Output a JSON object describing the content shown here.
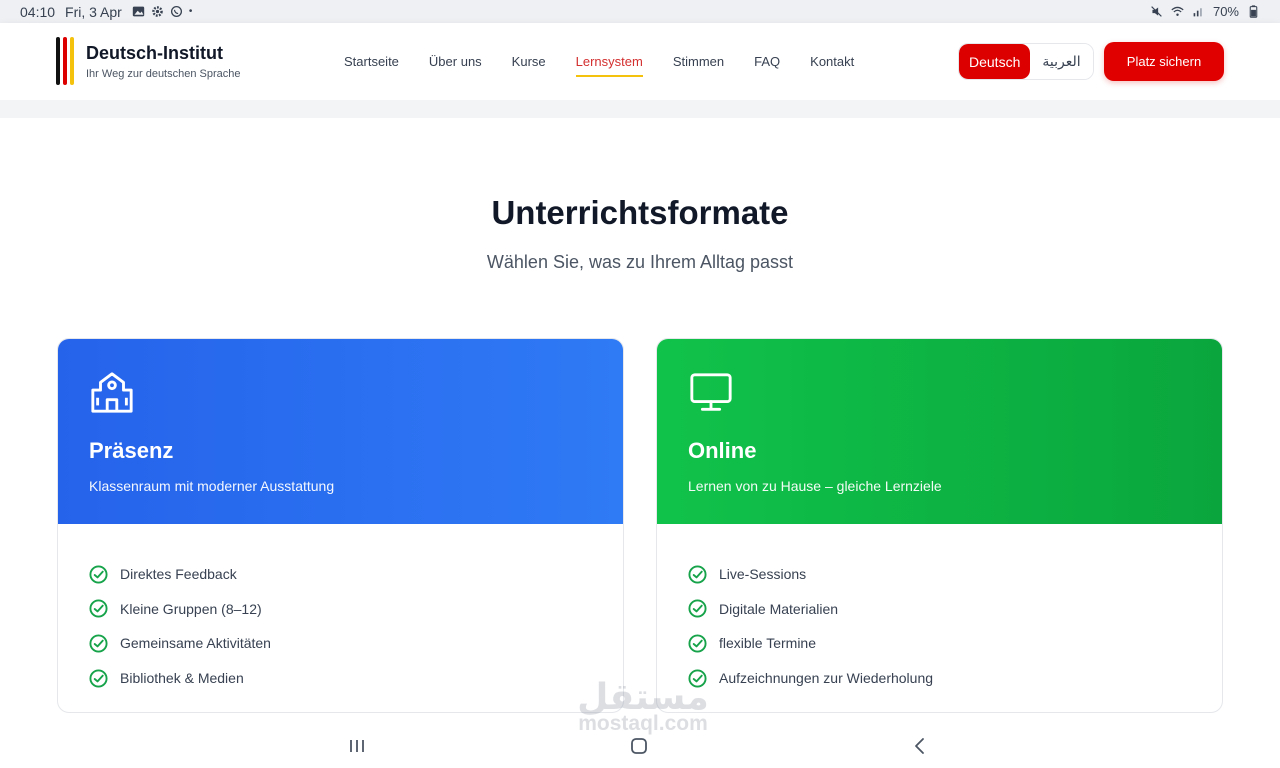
{
  "status": {
    "time": "04:10",
    "date": "Fri, 3 Apr",
    "battery": "70%"
  },
  "brand": {
    "title": "Deutsch-Institut",
    "subtitle": "Ihr Weg zur deutschen Sprache",
    "flag_colors": [
      "#111111",
      "#dd0000",
      "#f4c20d"
    ]
  },
  "nav": {
    "items": [
      {
        "label": "Startseite"
      },
      {
        "label": "Über uns"
      },
      {
        "label": "Kurse"
      },
      {
        "label": "Lernsystem",
        "active": true
      },
      {
        "label": "Stimmen"
      },
      {
        "label": "FAQ"
      },
      {
        "label": "Kontakt"
      }
    ]
  },
  "lang": {
    "german": "Deutsch",
    "arabic": "العربية",
    "selected": "Deutsch"
  },
  "cta_label": "Platz sichern",
  "section": {
    "title": "Unterrichtsformate",
    "subtitle": "Wählen Sie, was zu Ihrem Alltag passt"
  },
  "cards": [
    {
      "icon": "school-building-icon",
      "title": "Präsenz",
      "desc": "Klassenraum mit moderner Ausstattung",
      "color": "#2563eb",
      "features": [
        "Direktes Feedback",
        "Kleine Gruppen (8–12)",
        "Gemeinsame Aktivitäten",
        "Bibliothek & Medien"
      ]
    },
    {
      "icon": "monitor-icon",
      "title": "Online",
      "desc": "Lernen von zu Hause – gleiche Lernziele",
      "color": "#0fbf49",
      "features": [
        "Live-Sessions",
        "Digitale Materialien",
        "flexible Termine",
        "Aufzeichnungen zur Wiederholung"
      ]
    }
  ],
  "watermark": {
    "arabic": "مستقل",
    "latin": "mostaql.com"
  },
  "colors": {
    "accent_red": "#e00000",
    "check_green": "#16a34a"
  }
}
